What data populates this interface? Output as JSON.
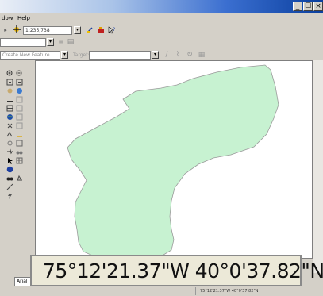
{
  "menubar": {
    "items": [
      "dow",
      "Help"
    ]
  },
  "toolbar": {
    "scale_value": "1:235,738"
  },
  "editor": {
    "create_features_label": "Create New Feature",
    "target_label": "Target:"
  },
  "map": {
    "polygon_fill": "#c7f2d1",
    "polygon_stroke": "#9a9a9a"
  },
  "coordinates": {
    "large_readout": "75°12'21.37\"W  40°0'37.82\"N",
    "status_readout": "75°12'21.37\"W  40°0'37.82\"N"
  },
  "drawing": {
    "font_value": "Arial"
  },
  "window_controls": {
    "minimize": "_",
    "maximize": "☐",
    "close": "×"
  }
}
